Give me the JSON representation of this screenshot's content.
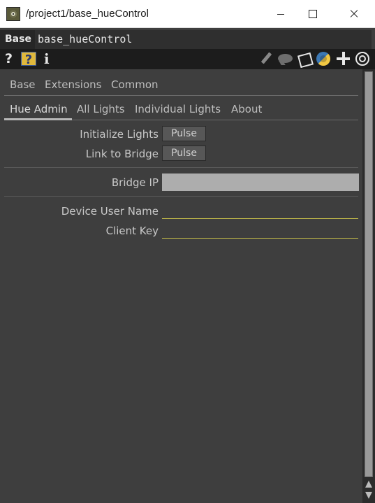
{
  "window": {
    "title": "/project1/base_hueControl"
  },
  "header": {
    "op_type": "Base",
    "op_name": "base_hueControl"
  },
  "toolbar": {
    "help_glyph": "?",
    "python_help_glyph": "?",
    "info_glyph": "i",
    "icons": [
      "help-icon",
      "python-help-icon",
      "info-icon",
      "edit-pencil-icon",
      "comment-bubble-icon",
      "clipboard-icon",
      "python-icon",
      "plus-icon",
      "target-icon"
    ]
  },
  "page_tabs_row1": [
    "Base",
    "Extensions",
    "Common"
  ],
  "page_tabs_row2": [
    "Hue Admin",
    "All Lights",
    "Individual Lights",
    "About"
  ],
  "active_tab": "Hue Admin",
  "params": {
    "initialize_lights": {
      "label": "Initialize Lights",
      "button": "Pulse"
    },
    "link_to_bridge": {
      "label": "Link to Bridge",
      "button": "Pulse"
    },
    "bridge_ip": {
      "label": "Bridge IP",
      "value": ""
    },
    "device_user_name": {
      "label": "Device User Name",
      "value": ""
    },
    "client_key": {
      "label": "Client Key",
      "value": ""
    }
  },
  "colors": {
    "panel_bg": "#3e3e3e",
    "field_underline": "#c9c04a",
    "ip_field": "#adadad",
    "pulse_button": "#575757"
  }
}
